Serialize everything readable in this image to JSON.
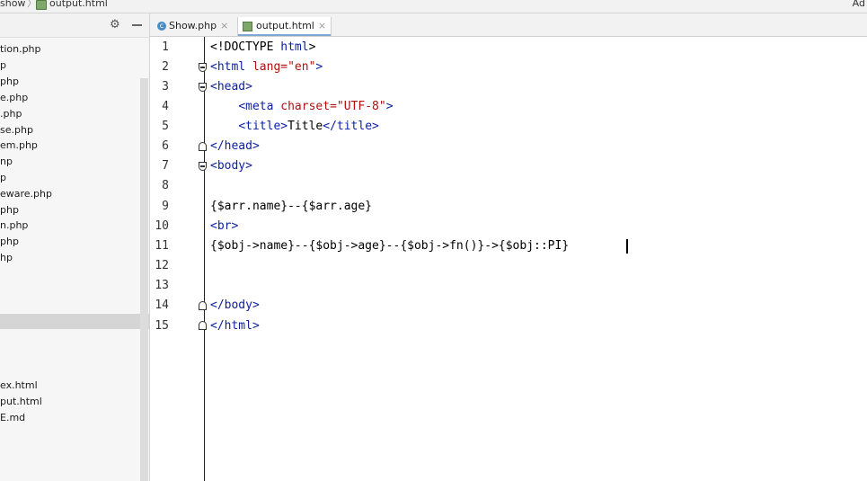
{
  "breadcrumb": {
    "folder": "show",
    "separator": "〉",
    "file": "output.html",
    "right_label": "Ad"
  },
  "project_panel": {
    "gear_icon": "gear-icon",
    "minimize_icon": "minimize-icon",
    "files": [
      "tion.php",
      "p",
      "php",
      "e.php",
      ".php",
      "se.php",
      "em.php",
      "np",
      "p",
      "eware.php",
      "php",
      "n.php",
      "php",
      "hp",
      "ex.html",
      "put.html",
      "E.md"
    ]
  },
  "tabs": [
    {
      "label": "Show.php",
      "icon": "php-file-icon",
      "close": "×",
      "active": false
    },
    {
      "label": "output.html",
      "icon": "html-file-icon",
      "close": "×",
      "active": true
    }
  ],
  "editor": {
    "line_numbers": [
      "1",
      "2",
      "3",
      "4",
      "5",
      "6",
      "7",
      "8",
      "9",
      "10",
      "11",
      "12",
      "13",
      "14",
      "15"
    ],
    "code": {
      "l1": {
        "a": "<!DOCTYPE ",
        "b": "html",
        "c": ">"
      },
      "l2": {
        "a": "<html ",
        "b": "lang=",
        "c": "\"en\"",
        "d": ">"
      },
      "l3": {
        "a": "<head>"
      },
      "l4": {
        "indent": "    ",
        "a": "<meta ",
        "b": "charset=",
        "c": "\"UTF-8\"",
        "d": ">"
      },
      "l5": {
        "indent": "    ",
        "a": "<title>",
        "b": "Title",
        "c": "</title>"
      },
      "l6": {
        "a": "</head>"
      },
      "l7": {
        "a": "<body>"
      },
      "l9": {
        "a": "{$arr.name}--{$arr.age}"
      },
      "l10": {
        "a": "<br>"
      },
      "l11": {
        "a": "{$obj->name}--{$obj->age}--{$obj->fn()}->{$obj::PI}"
      },
      "l14": {
        "a": "</body>"
      },
      "l15": {
        "a": "</html>"
      }
    }
  },
  "colors": {
    "tag": "#0a1f9e",
    "attribute": "#b01010",
    "tab_underline": "#7aa7d6"
  }
}
